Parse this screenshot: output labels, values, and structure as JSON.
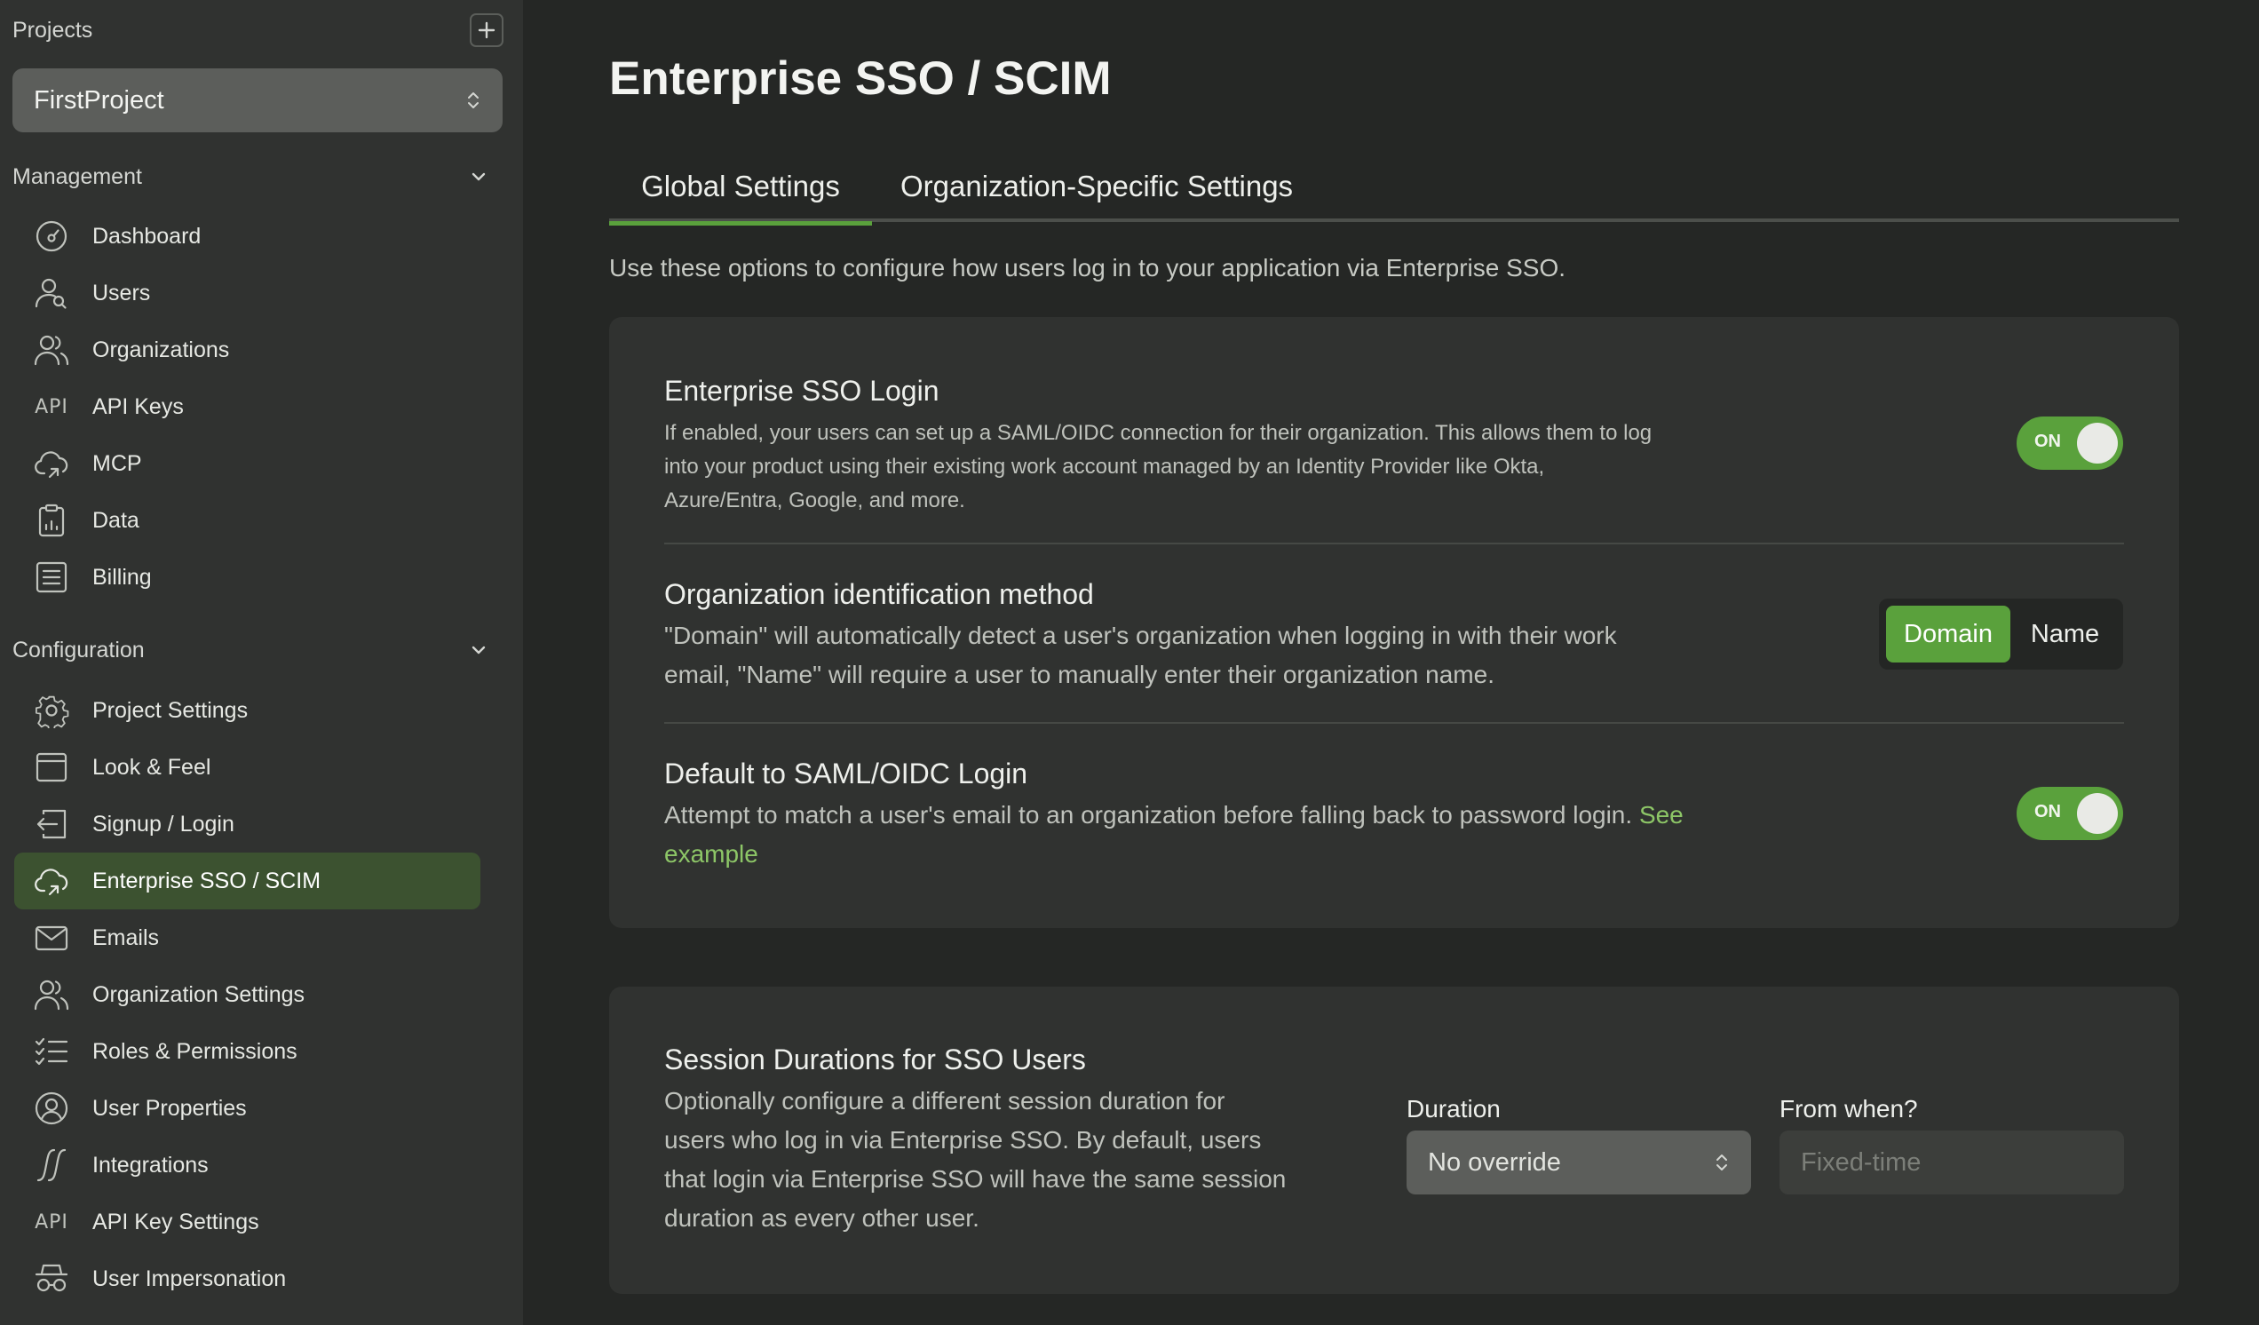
{
  "sidebar": {
    "projects_label": "Projects",
    "project_name": "FirstProject",
    "management_label": "Management",
    "management_items": [
      {
        "label": "Dashboard",
        "icon": "dashboard-icon"
      },
      {
        "label": "Users",
        "icon": "users-icon"
      },
      {
        "label": "Organizations",
        "icon": "organizations-icon"
      },
      {
        "label": "API Keys",
        "icon": "api-icon"
      },
      {
        "label": "MCP",
        "icon": "cloud-icon"
      },
      {
        "label": "Data",
        "icon": "clipboard-icon"
      },
      {
        "label": "Billing",
        "icon": "billing-icon"
      }
    ],
    "configuration_label": "Configuration",
    "configuration_items": [
      {
        "label": "Project Settings",
        "icon": "gear-icon"
      },
      {
        "label": "Look & Feel",
        "icon": "window-icon"
      },
      {
        "label": "Signup / Login",
        "icon": "login-icon"
      },
      {
        "label": "Enterprise SSO / SCIM",
        "icon": "cloud-icon",
        "active": true
      },
      {
        "label": "Emails",
        "icon": "mail-icon"
      },
      {
        "label": "Organization Settings",
        "icon": "organizations-icon"
      },
      {
        "label": "Roles & Permissions",
        "icon": "checklist-icon"
      },
      {
        "label": "User Properties",
        "icon": "user-circle-icon"
      },
      {
        "label": "Integrations",
        "icon": "integration-icon"
      },
      {
        "label": "API Key Settings",
        "icon": "api-icon"
      },
      {
        "label": "User Impersonation",
        "icon": "impersonation-icon"
      }
    ],
    "api_glyph": "API"
  },
  "main": {
    "title": "Enterprise SSO / SCIM",
    "tabs": [
      {
        "label": "Global Settings",
        "active": true
      },
      {
        "label": "Organization-Specific Settings",
        "active": false
      }
    ],
    "intro": "Use these options to configure how users log in to your application via Enterprise SSO.",
    "sso_login": {
      "title": "Enterprise SSO Login",
      "desc_lines": [
        "If enabled, your users can set up a SAML/OIDC connection for their organization. This allows them to log",
        "into your product using their existing work account managed by an Identity Provider like Okta,",
        "Azure/Entra, Google, and more."
      ],
      "toggle": "ON"
    },
    "org_method": {
      "title": "Organization identification method",
      "desc_lines": [
        "\"Domain\" will automatically detect a user's organization when logging in with their work",
        "email, \"Name\" will require a user to manually enter their organization name."
      ],
      "options": [
        "Domain",
        "Name"
      ],
      "selected": "Domain"
    },
    "default_saml": {
      "title": "Default to SAML/OIDC Login",
      "desc_line1": "Attempt to match a user's email to an organization before falling back to password login.",
      "link_part1": "See",
      "link_part2": "example",
      "toggle": "ON"
    },
    "session": {
      "title": "Session Durations for SSO Users",
      "desc_lines": [
        "Optionally configure a different session duration for",
        "users who log in via Enterprise SSO. By default, users",
        "that login via Enterprise SSO will have the same session",
        "duration as every other user."
      ],
      "duration_label": "Duration",
      "duration_value": "No override",
      "from_label": "From when?",
      "from_placeholder": "Fixed-time"
    }
  },
  "colors": {
    "accent": "#5aa13c",
    "active_nav_bg": "#3c5230",
    "link": "#8dc667"
  }
}
